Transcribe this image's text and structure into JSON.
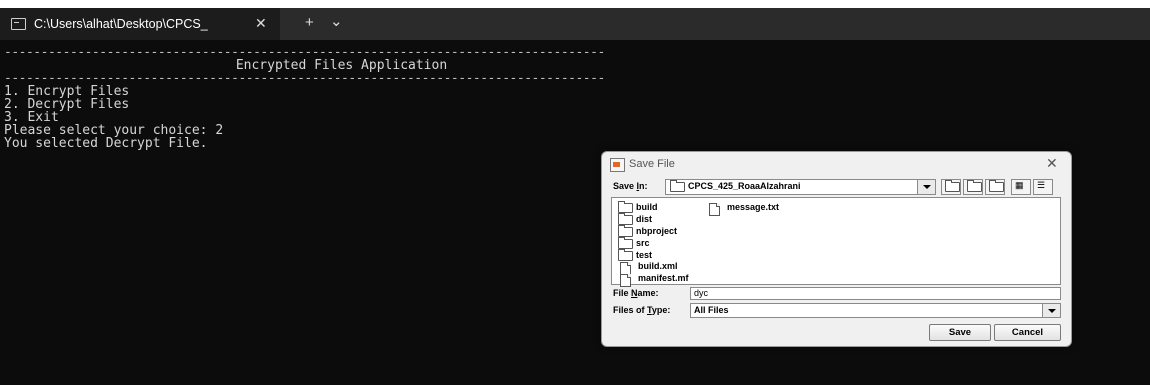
{
  "terminal": {
    "tab_title": "C:\\Users\\alhat\\Desktop\\CPCS_",
    "tab_close": "✕",
    "new_tab": "+",
    "dropdown": "⌄",
    "separator": "----------------------------------------------------------------------------------",
    "heading": "Encrypted Files Application",
    "lines": [
      "1. Encrypt Files",
      "2. Decrypt Files",
      "3. Exit",
      "Please select your choice: 2",
      "You selected Decrypt File."
    ]
  },
  "dialog": {
    "title": "Save File",
    "close": "✕",
    "save_in_label_pre": "Save ",
    "save_in_label_key": "I",
    "save_in_label_post": "n:",
    "save_in_value": "CPCS_425_RoaaAlzahrani",
    "toolbar_icons": [
      "up-one-level-icon",
      "home-icon",
      "new-folder-icon",
      "list-view-icon",
      "details-view-icon"
    ],
    "files": [
      {
        "name": "build",
        "icon": "folder"
      },
      {
        "name": "dist",
        "icon": "folder"
      },
      {
        "name": "nbproject",
        "icon": "folder"
      },
      {
        "name": "src",
        "icon": "folder"
      },
      {
        "name": "test",
        "icon": "folder"
      },
      {
        "name": "build.xml",
        "icon": "file"
      },
      {
        "name": "manifest.mf",
        "icon": "file"
      },
      {
        "name": "message.txt",
        "icon": "file"
      }
    ],
    "file_name_label_pre": "File ",
    "file_name_label_key": "N",
    "file_name_label_post": "ame:",
    "file_name_value": "dyc",
    "file_type_label_pre": "Files of ",
    "file_type_label_key": "T",
    "file_type_label_post": "ype:",
    "file_type_value": "All Files",
    "save_button": "Save",
    "cancel_button": "Cancel"
  },
  "colors": {
    "terminal_bg": "#0c0c0c",
    "terminal_text": "#d6d6d6",
    "dialog_bg": "#f0f0f0"
  }
}
